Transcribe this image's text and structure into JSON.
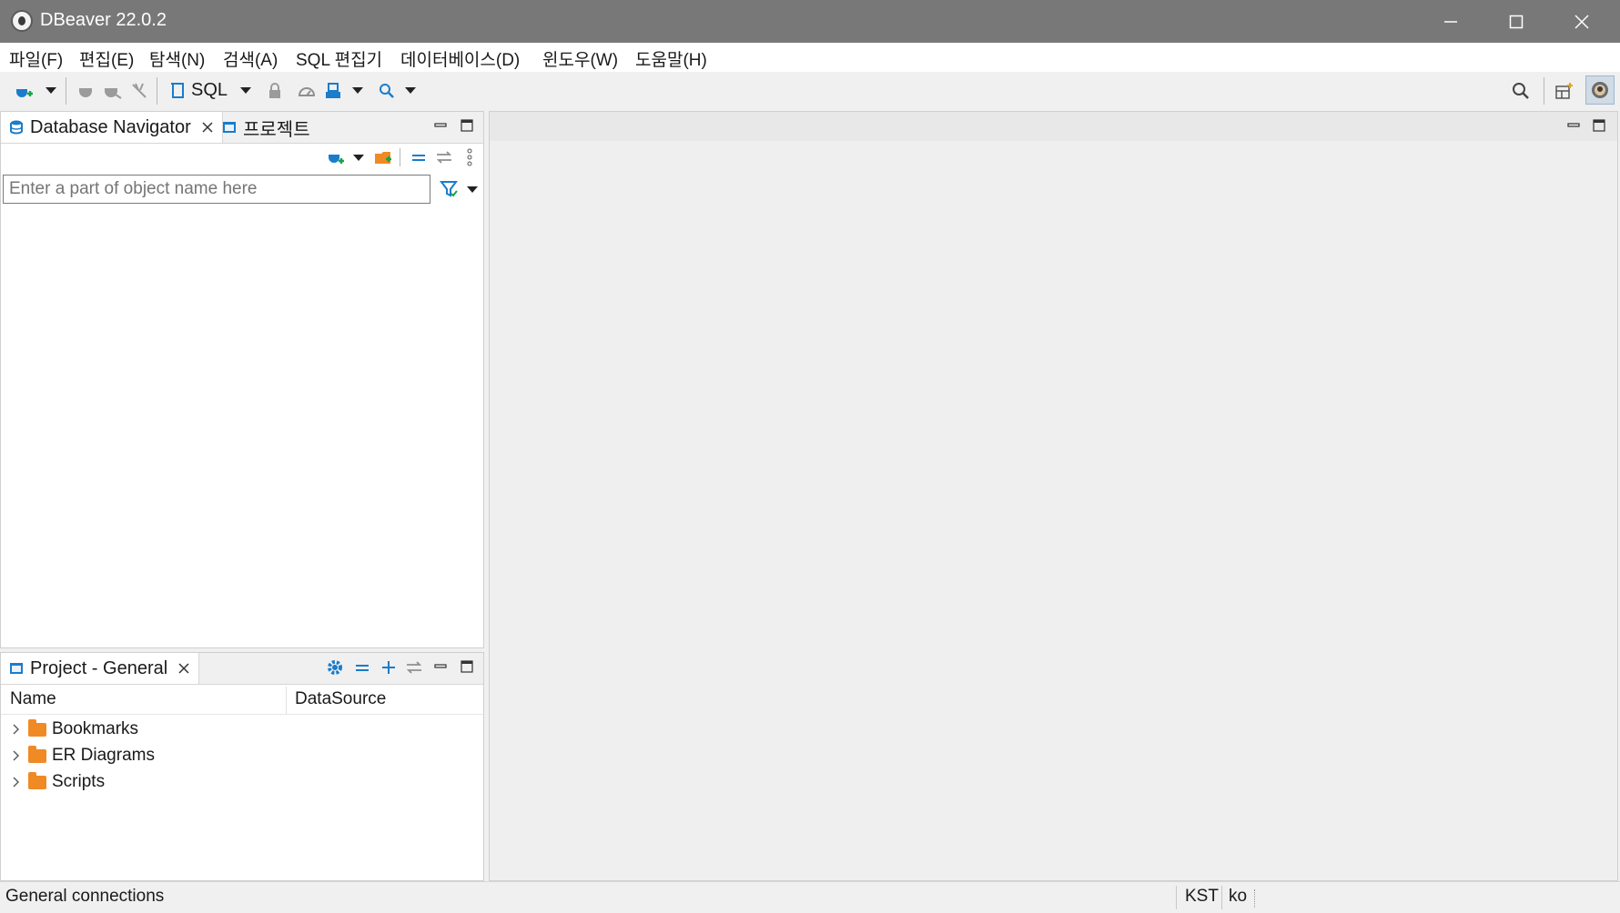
{
  "window": {
    "title": "DBeaver 22.0.2",
    "controls": [
      "minimize-icon",
      "maximize-icon",
      "close-icon"
    ]
  },
  "menu": [
    "파일(F)",
    "편집(E)",
    "탐색(N)",
    "검색(A)",
    "SQL 편집기",
    "데이터베이스(D)",
    "윈도우(W)",
    "도움말(H)"
  ],
  "toolbar": {
    "sql_label": "SQL",
    "icons": [
      "new-connection-icon",
      "connect-icon",
      "disconnect-icon",
      "disconnect-all-icon",
      "sql-editor-icon",
      "lock-icon",
      "dashboard-icon",
      "transaction-icon",
      "search-icon"
    ]
  },
  "navigator": {
    "tab_label": "Database Navigator",
    "projects_tab_label": "프로젝트",
    "filter_placeholder": "Enter a part of object name here"
  },
  "project_panel": {
    "tab_label": "Project - General",
    "columns": [
      "Name",
      "DataSource"
    ],
    "items": [
      {
        "label": "Bookmarks",
        "icon": "bookmarks-folder-icon"
      },
      {
        "label": "ER Diagrams",
        "icon": "er-diagrams-folder-icon"
      },
      {
        "label": "Scripts",
        "icon": "scripts-folder-icon"
      }
    ]
  },
  "status": {
    "left": "General connections",
    "timezone": "KST",
    "locale": "ko"
  },
  "colors": {
    "titlebar": "#787878",
    "accent_blue": "#1a7ccb",
    "folder_orange": "#f08a24",
    "panel_bg": "#ffffff",
    "workspace_bg": "#efefef"
  }
}
